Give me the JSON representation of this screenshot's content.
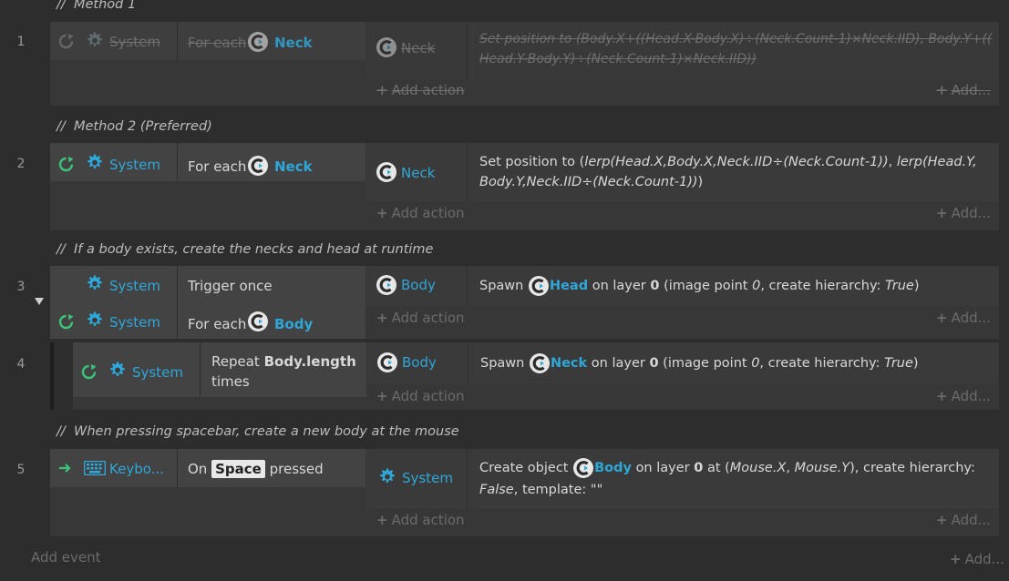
{
  "comments": {
    "c1": "Method 1",
    "c2": "Method 2 (Preferred)",
    "c3": "If a body exists, create the necks and head at runtime",
    "c4": "When pressing spacebar, create a new body at the mouse"
  },
  "row_numbers": [
    "1",
    "2",
    "3",
    "4",
    "5"
  ],
  "labels": {
    "system": "System",
    "keyboard": "Keybo...",
    "add_action": "Add action",
    "add_more": "Add...",
    "add_event": "Add event"
  },
  "events": {
    "e1": {
      "cond_text": "For each",
      "cond_obj": "Neck",
      "action_obj": "Neck",
      "action_text_1": "Set position to (Body.X+((Head.X-Body.X)÷(Neck.Count-1)×Neck.IID), Body.Y+((",
      "action_text_2": "Head.Y-Body.Y)÷(Neck.Count-1)×Neck.IID))"
    },
    "e2": {
      "cond_text": "For each",
      "cond_obj": "Neck",
      "action_obj": "Neck",
      "action_prefix": "Set position to (",
      "action_expr_1": "lerp(Head.X,Body.X,Neck.IID÷(Neck.Count-1))",
      "action_mid": ", ",
      "action_expr_2": "lerp(Head.Y,",
      "action_expr_3": "Body.Y,Neck.IID÷(Neck.Count-1))",
      "action_suffix": ")"
    },
    "e3": {
      "cond1_text": "Trigger once",
      "cond2_text": "For each",
      "cond2_obj": "Body",
      "action_obj": "Body",
      "action_spawn": "Spawn",
      "action_spawn_obj": "Head",
      "action_on_layer": "on layer",
      "action_layer": "0",
      "action_image_point": "(image point",
      "action_point_val": "0",
      "action_hierarchy": ", create hierarchy:",
      "action_hier_val": "True",
      "action_close": ")"
    },
    "e4": {
      "cond_text": "Repeat",
      "cond_expr": "Body.length",
      "cond_times": "times",
      "action_obj": "Body",
      "action_spawn": "Spawn",
      "action_spawn_obj": "Neck",
      "action_on_layer": "on layer",
      "action_layer": "0",
      "action_image_point": "(image point",
      "action_point_val": "0",
      "action_hierarchy": ", create hierarchy:",
      "action_hier_val": "True",
      "action_close": ")"
    },
    "e5": {
      "cond_on": "On",
      "cond_key": "Space",
      "cond_pressed": "pressed",
      "action_create": "Create object",
      "action_obj": "Body",
      "action_on_layer": "on layer",
      "action_layer": "0",
      "action_at": "at (",
      "action_mx": "Mouse.X",
      "action_comma": ", ",
      "action_my": "Mouse.Y",
      "action_hierarchy": "), create hierarchy:",
      "action_false": "False",
      "action_template": ", template: \"\""
    }
  },
  "colors": {
    "accent": "#2fa7d8",
    "loop_green": "#3cc47c",
    "background": "#2d2d2d"
  },
  "icons": [
    "gear-icon",
    "loop-icon",
    "object-c-icon",
    "keyboard-icon",
    "arrow-right-icon",
    "collapse-triangle-icon"
  ]
}
